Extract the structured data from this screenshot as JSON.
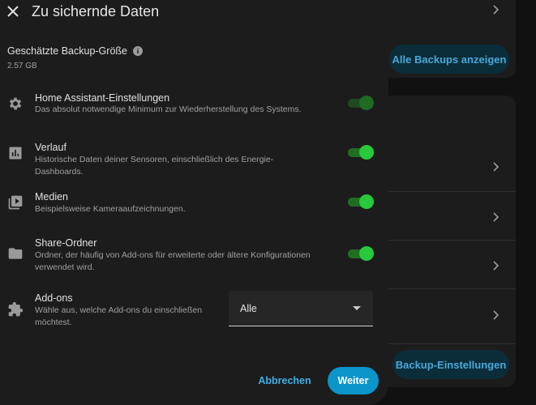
{
  "background": {
    "show_all_backups_label": "Alle Backups anzeigen",
    "backup_settings_label": "Backup-Einstellungen"
  },
  "dialog": {
    "title": "Zu sichernde Daten",
    "estimated_size_label": "Geschätzte Backup-Größe",
    "estimated_size_value": "2.57 GB",
    "rows": [
      {
        "icon": "gear-icon",
        "title": "Home Assistant-Einstellungen",
        "description": "Das absolut notwendige Minimum zur Wiederherstellung des Systems.",
        "enabled": true,
        "disabled_state": true
      },
      {
        "icon": "chart-icon",
        "title": "Verlauf",
        "description": "Historische Daten deiner Sensoren, einschließlich des Energie-Dashboards.",
        "enabled": true
      },
      {
        "icon": "media-icon",
        "title": "Medien",
        "description": "Beispielsweise Kameraaufzeichnungen.",
        "enabled": true
      },
      {
        "icon": "folder-icon",
        "title": "Share-Ordner",
        "description": "Ordner, der häufig von Add-ons für erweiterte oder ältere Konfigurationen verwendet wird.",
        "enabled": true
      }
    ],
    "addons": {
      "icon": "puzzle-icon",
      "title": "Add-ons",
      "description": "Wähle aus, welche Add-ons du einschließen möchtest.",
      "selected": "Alle"
    },
    "cancel_label": "Abbrechen",
    "next_label": "Weiter"
  },
  "colors": {
    "accent": "#0b95c9",
    "toggle_on": "#28c93a",
    "link": "#3fb0e4"
  }
}
